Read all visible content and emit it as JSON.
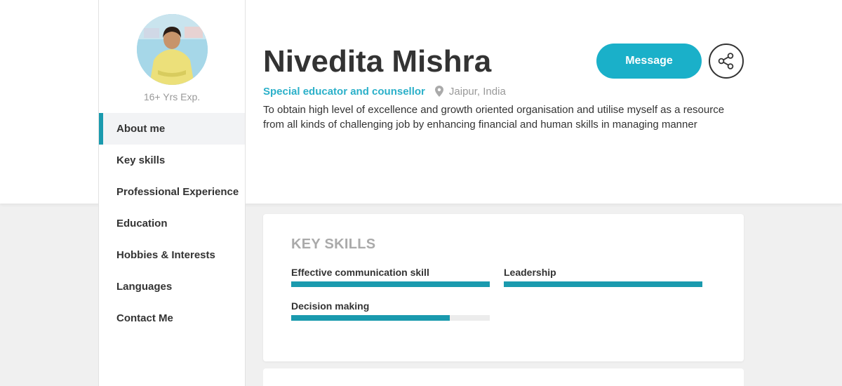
{
  "profile": {
    "name": "Nivedita Mishra",
    "job_title": "Special educator and counsellor",
    "location": "Jaipur, India",
    "experience": "16+ Yrs Exp.",
    "summary": "To obtain high level of excellence and growth oriented organisation and utilise myself as a resource from all kinds of challenging job by enhancing financial and human skills in managing manner"
  },
  "actions": {
    "message_label": "Message",
    "share_icon": "share-icon",
    "location_icon": "map-pin-icon"
  },
  "nav": {
    "items": [
      {
        "label": "About me",
        "active": true
      },
      {
        "label": "Key skills",
        "active": false
      },
      {
        "label": "Professional Experience",
        "active": false
      },
      {
        "label": "Education",
        "active": false
      },
      {
        "label": "Hobbies & Interests",
        "active": false
      },
      {
        "label": "Languages",
        "active": false
      },
      {
        "label": "Contact Me",
        "active": false
      }
    ]
  },
  "key_skills": {
    "title": "KEY SKILLS",
    "skills": [
      {
        "label": "Effective communication skill",
        "level": 1.0
      },
      {
        "label": "Leadership",
        "level": 1.0
      },
      {
        "label": "Decision making",
        "level": 0.8
      }
    ]
  },
  "colors": {
    "accent": "#1ab0c9",
    "bar_fill": "#1a9aae",
    "job_title": "#2bb0c9",
    "muted": "#999999"
  }
}
